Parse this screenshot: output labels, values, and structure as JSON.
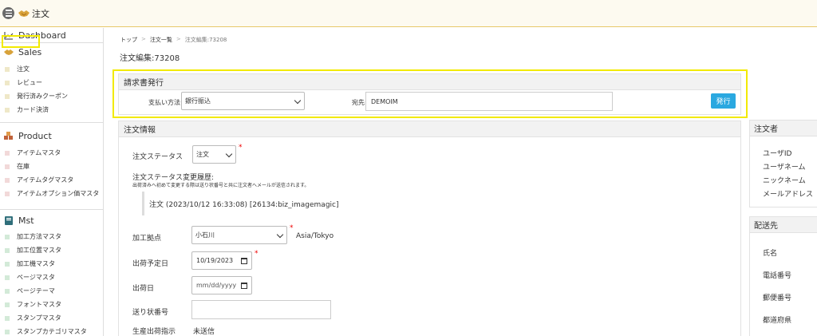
{
  "header": {
    "app_title": "注文"
  },
  "sidebar": {
    "dashboard": "Dashboard",
    "sales": {
      "title": "Sales",
      "items": [
        "注文",
        "レビュー",
        "発行済みクーポン",
        "カード決済"
      ]
    },
    "product": {
      "title": "Product",
      "items": [
        "アイテムマスタ",
        "在庫",
        "アイテムタグマスタ",
        "アイテムオプション価マスタ"
      ]
    },
    "mst": {
      "title": "Mst",
      "items": [
        "加工方法マスタ",
        "加工位置マスタ",
        "加工機マスタ",
        "ページマスタ",
        "ページテーマ",
        "フォントマスタ",
        "スタンプマスタ",
        "スタンプカテゴリマスタ"
      ]
    }
  },
  "breadcrumb": {
    "items": [
      "トップ",
      "注文一覧",
      "注文編集:73208"
    ]
  },
  "page_title": "注文編集:73208",
  "invoice": {
    "title": "請求書発行",
    "payment_label": "支払い方法:",
    "payment_value": "銀行振込",
    "destination_label": "宛先:",
    "destination_value": "DEMOIM",
    "issue_button": "発行"
  },
  "order_info": {
    "title": "注文情報",
    "status_label": "注文ステータス",
    "status_value": "注文",
    "history_label": "注文ステータス変更履歴:",
    "history_note": "出荷済みへ初めて変更する際は送り状番号と共に注文者へメールが送信されます。",
    "history_entry": "注文 (2023/10/12 16:33:08) [26134:biz_imagemagic]",
    "factory_label": "加工拠点",
    "factory_value": "小石川",
    "timezone": "Asia/Tokyo",
    "planned_ship_label": "出荷予定日",
    "planned_ship_value": "10/19/2023",
    "ship_date_label": "出荷日",
    "ship_date_placeholder": "mm/dd/yyyy",
    "tracking_label": "送り状番号",
    "tracking_value": "",
    "production_label": "生産出荷指示",
    "production_value": "未送信"
  },
  "orderer": {
    "title": "注文者",
    "fields": [
      "ユーザID",
      "ユーザネーム",
      "ニックネーム",
      "メールアドレス"
    ]
  },
  "shipping": {
    "title": "配送先",
    "fields": [
      "氏名",
      "電話番号",
      "郵便番号",
      "都道府県"
    ]
  },
  "required_mark": "*",
  "colors": {
    "highlight": "#f2ea00",
    "issue_button": "#2aa8e0",
    "required": "#e00000"
  }
}
